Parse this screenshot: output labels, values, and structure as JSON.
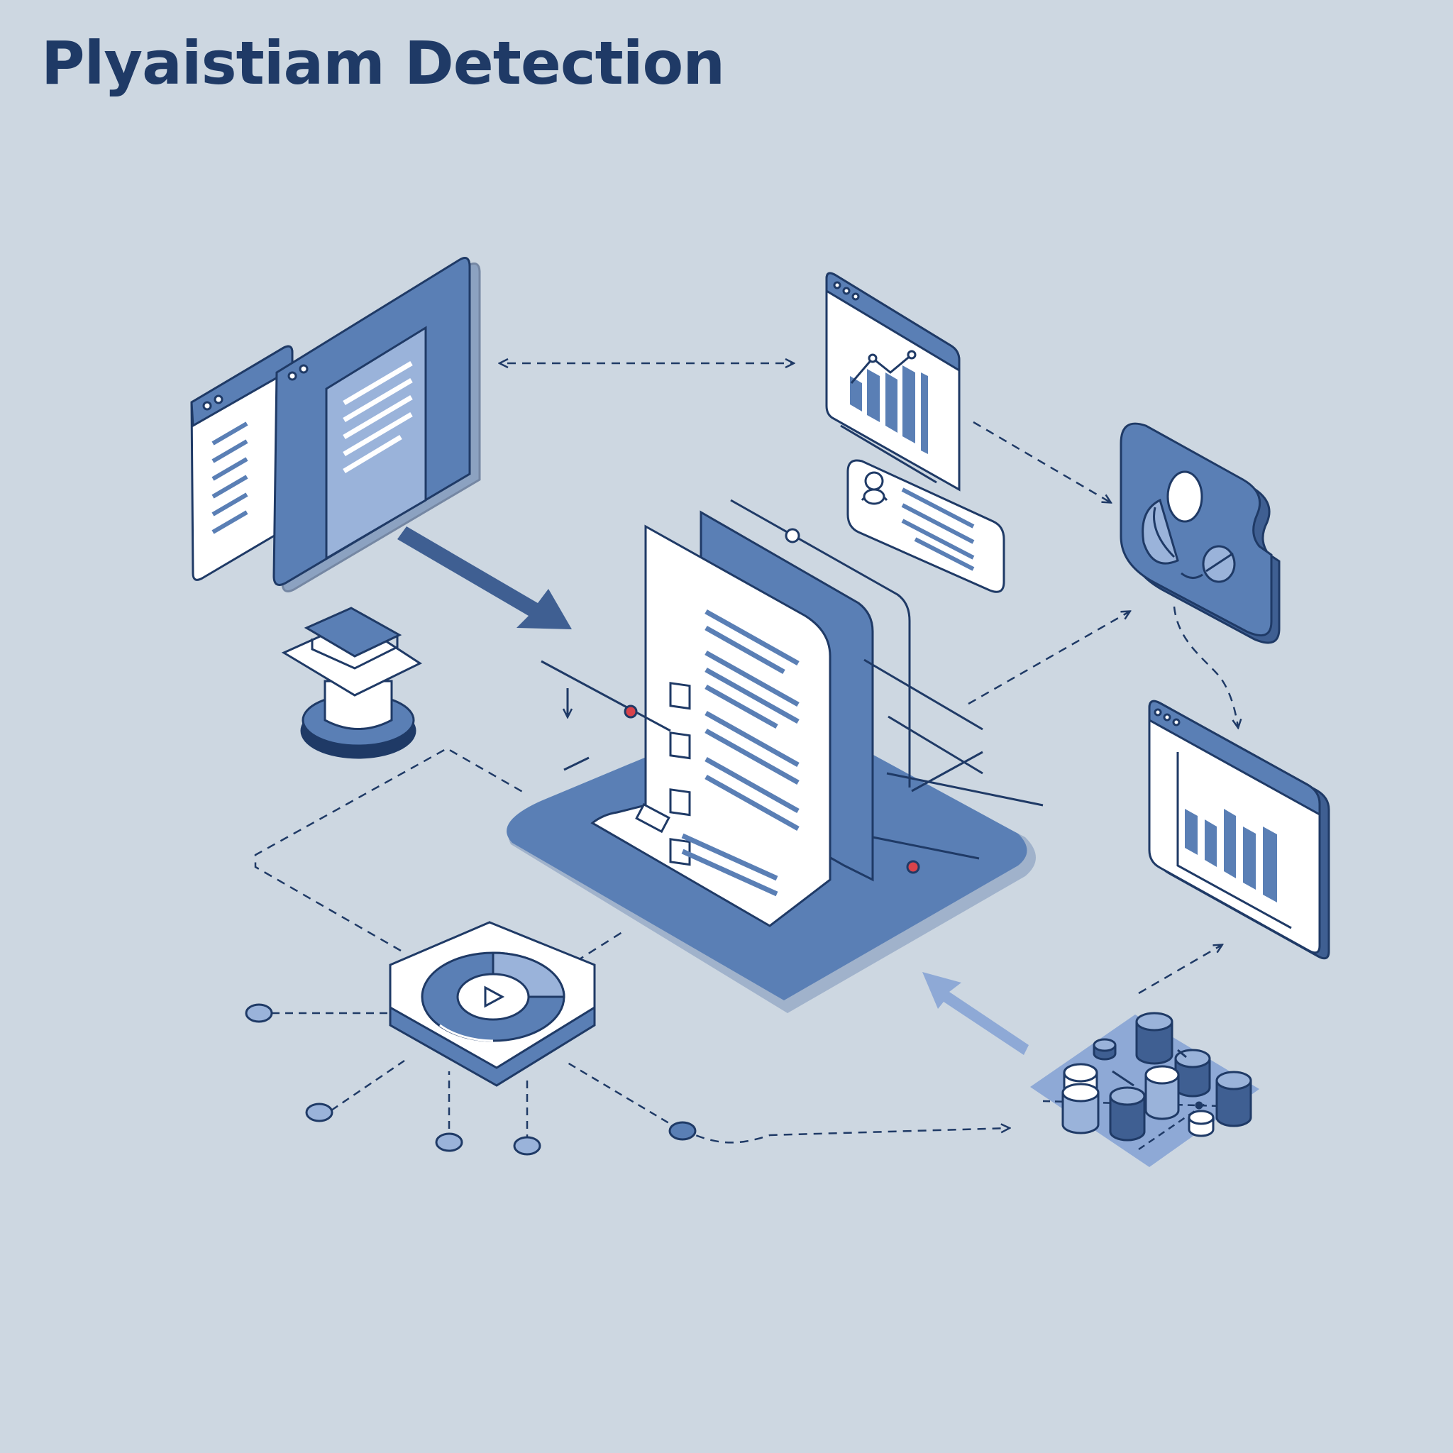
{
  "title": "Plyaistiam Detection",
  "colors": {
    "background": "#cdd7e1",
    "navy": "#1f3a66",
    "mid_blue": "#5a7fb5",
    "light_blue": "#9ab3da",
    "paper": "#ffffff",
    "accent_red": "#d9434b"
  },
  "icons": [
    "document-window-icon",
    "graduation-cap-icon",
    "bar-chart-window-icon",
    "user-card-icon",
    "pie-chart-badge-icon",
    "report-window-icon",
    "play-hub-icon",
    "database-cluster-icon",
    "checklist-document-icon"
  ]
}
